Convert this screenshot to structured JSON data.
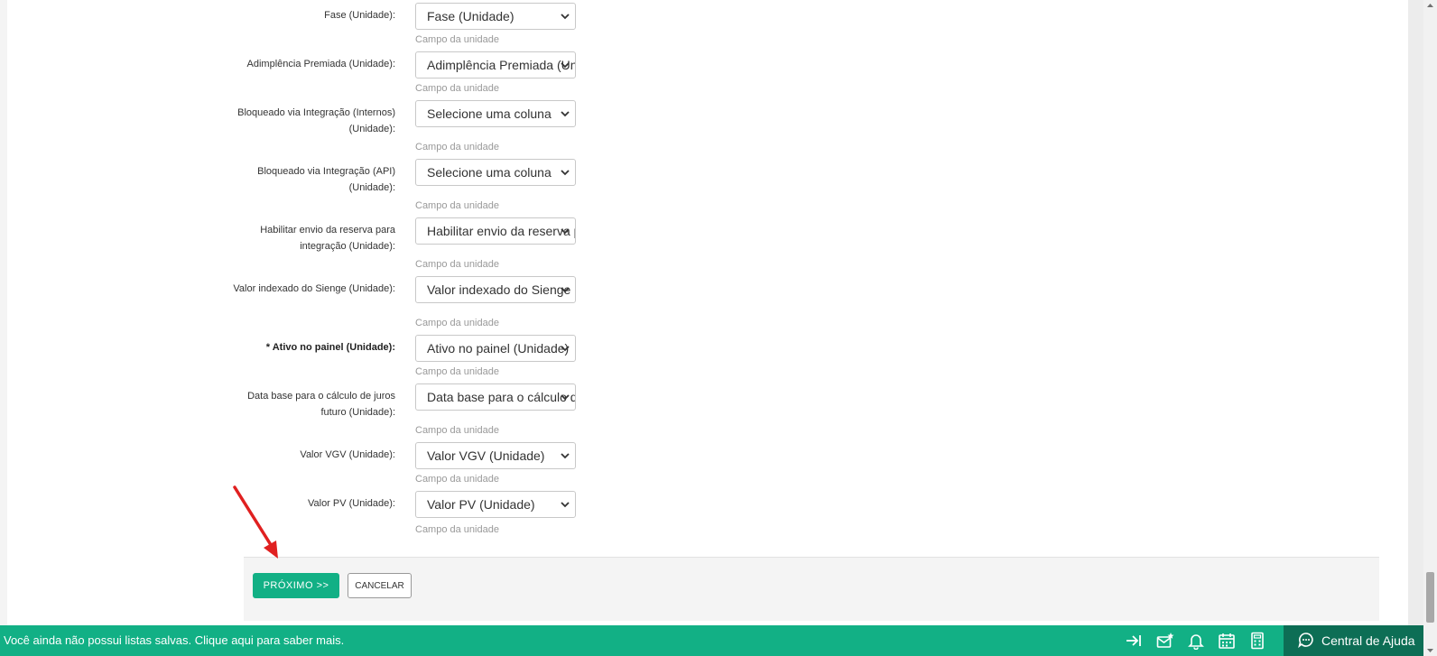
{
  "fields": [
    {
      "label": "Fase (Unidade):",
      "value": "Fase (Unidade)",
      "hint": "Campo da unidade",
      "required": false
    },
    {
      "label": "Adimplência Premiada (Unidade):",
      "value": "Adimplência Premiada (Unidade)",
      "hint": "Campo da unidade",
      "required": false
    },
    {
      "label": "Bloqueado via Integração (Internos) (Unidade):",
      "value": "Selecione uma coluna",
      "hint": "Campo da unidade",
      "required": false
    },
    {
      "label": "Bloqueado via Integração (API) (Unidade):",
      "value": "Selecione uma coluna",
      "hint": "Campo da unidade",
      "required": false
    },
    {
      "label": "Habilitar envio da reserva para integração (Unidade):",
      "value": "Habilitar envio da reserva para integração (Unidade)",
      "hint": "Campo da unidade",
      "required": false
    },
    {
      "label": "Valor indexado do Sienge (Unidade):",
      "value": "Valor indexado do Sienge (Unidade)",
      "hint": "Campo da unidade",
      "required": false
    },
    {
      "label": "* Ativo no painel (Unidade):",
      "value": "Ativo no painel (Unidade)",
      "hint": "Campo da unidade",
      "required": true
    },
    {
      "label": "Data base para o cálculo de juros futuro (Unidade):",
      "value": "Data base para o cálculo de juros futuro (Unidade)",
      "hint": "Campo da unidade",
      "required": false
    },
    {
      "label": "Valor VGV (Unidade):",
      "value": "Valor VGV (Unidade)",
      "hint": "Campo da unidade",
      "required": false
    },
    {
      "label": "Valor PV (Unidade):",
      "value": "Valor PV (Unidade)",
      "hint": "Campo da unidade",
      "required": false
    }
  ],
  "actions": {
    "next_label": "PRÓXIMO >>",
    "cancel_label": "CANCELAR"
  },
  "bottom_bar": {
    "message": "Você ainda não possui listas salvas. Clique aqui para saber mais.",
    "help_label": "Central de Ajuda",
    "icons": [
      "collapse-arrow-icon",
      "mail-star-icon",
      "bell-icon",
      "calendar-icon",
      "calculator-icon",
      "chat-help-icon"
    ]
  },
  "colors": {
    "accent": "#12b085",
    "help_dark": "#0d6e55",
    "annotation_arrow": "#e02020"
  }
}
